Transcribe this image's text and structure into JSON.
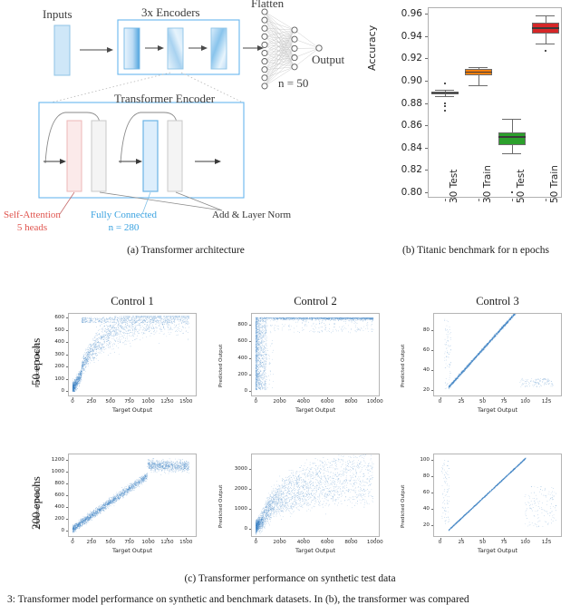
{
  "figure": {
    "caption_a": "(a) Transformer architecture",
    "caption_b": "(b) Titanic benchmark for n epochs",
    "caption_c": "(c) Transformer performance on synthetic test data",
    "caption_fig": "3: Transformer model performance on synthetic and benchmark datasets. In (b), the transformer was compared"
  },
  "architecture": {
    "inputs_label": "Inputs",
    "encoders_label": "3x Encoders",
    "flatten_label": "Flatten",
    "output_label": "Output",
    "dense_n_label": "n = 50",
    "encoder_box_label": "Transformer Encoder",
    "self_attention_label": "Self-Attention",
    "self_attention_sub": "5 heads",
    "fully_connected_label": "Fully Connected",
    "fully_connected_sub": "n = 280",
    "add_norm_label": "Add & Layer Norm",
    "colors": {
      "attention": "#fbe9e9",
      "attention_text": "#e0554f",
      "fully_connected": "#ddeefc",
      "fully_connected_text": "#3aa2e0",
      "box_border": "#67b6ee",
      "norm": "#f2f2f2"
    }
  },
  "chart_data": [
    {
      "id": "titanic-boxplot",
      "type": "boxplot",
      "title": "",
      "xlabel": "",
      "ylabel": "Accuracy",
      "ylim": [
        0.795,
        0.966
      ],
      "yticks": [
        0.8,
        0.82,
        0.84,
        0.86,
        0.88,
        0.9,
        0.92,
        0.94,
        0.96
      ],
      "ytick_labels": [
        "0.80",
        "0.82",
        "0.84",
        "0.86",
        "0.88",
        "0.90",
        "0.92",
        "0.94",
        "0.96"
      ],
      "categories": [
        "30 Test",
        "30 Train",
        "50 Test",
        "50 Train"
      ],
      "colors": [
        "#1f77b4",
        "#ff7f0e",
        "#2ca02c",
        "#d62728"
      ],
      "boxes": [
        {
          "label": "30 Test",
          "q1": 0.8875,
          "median": 0.889,
          "q3": 0.89,
          "whisker_low": 0.8865,
          "whisker_high": 0.8915,
          "fliers": [
            0.8975,
            0.88,
            0.8775,
            0.873
          ]
        },
        {
          "label": "30 Train",
          "q1": 0.905,
          "median": 0.9078,
          "q3": 0.9105,
          "whisker_low": 0.896,
          "whisker_high": 0.912,
          "fliers": []
        },
        {
          "label": "50 Test",
          "q1": 0.842,
          "median": 0.8495,
          "q3": 0.854,
          "whisker_low": 0.835,
          "whisker_high": 0.866,
          "fliers": [
            0.7995
          ]
        },
        {
          "label": "50 Train",
          "q1": 0.9425,
          "median": 0.9475,
          "q3": 0.952,
          "whisker_low": 0.9335,
          "whisker_high": 0.9585,
          "fliers": [
            0.927
          ]
        }
      ]
    },
    {
      "id": "control-1-50-epochs",
      "type": "scatter",
      "title": "Control 1",
      "row_label": "50 epochs",
      "xlabel": "Target Output",
      "ylabel": "Predicted Output",
      "xlim": [
        -60,
        1640
      ],
      "ylim": [
        -45,
        640
      ],
      "xticks": [
        0,
        250,
        500,
        750,
        1000,
        1250,
        1500
      ],
      "yticks": [
        0,
        100,
        200,
        300,
        400,
        500,
        600
      ],
      "point_color": "#3a7fc1",
      "n_points": 3000,
      "pattern": "saturating-fan",
      "saturation_y": 600
    },
    {
      "id": "control-2-50-epochs",
      "type": "scatter",
      "title": "Control 2",
      "row_label": "50 epochs",
      "xlabel": "Target Output",
      "ylabel": "Predicted Output",
      "xlim": [
        -400,
        10400
      ],
      "ylim": [
        -60,
        940
      ],
      "xticks": [
        0,
        2000,
        4000,
        6000,
        8000,
        10000
      ],
      "yticks": [
        0,
        200,
        400,
        600,
        800
      ],
      "point_color": "#3a7fc1",
      "n_points": 3000,
      "pattern": "hard-saturation-left-column",
      "saturation_y": 890
    },
    {
      "id": "control-3-50-epochs",
      "type": "scatter",
      "title": "Control 3",
      "row_label": "50 epochs",
      "xlabel": "Target Output",
      "ylabel": "Predicted Output",
      "xlim": [
        -8,
        143
      ],
      "ylim": [
        14,
        97
      ],
      "xticks": [
        0,
        25,
        50,
        75,
        100,
        125
      ],
      "yticks": [
        20,
        40,
        60,
        80
      ],
      "point_color": "#3a7fc1",
      "n_points": 2200,
      "pattern": "diagonal-with-offcluster",
      "slope": 0.95
    },
    {
      "id": "control-1-200-epochs",
      "type": "scatter",
      "title": "Control 1",
      "row_label": "200 epochs",
      "xlabel": "Target Output",
      "ylabel": "Predicted Output",
      "xlim": [
        -60,
        1640
      ],
      "ylim": [
        -110,
        1300
      ],
      "xticks": [
        0,
        250,
        500,
        750,
        1000,
        1250,
        1500
      ],
      "yticks": [
        0,
        200,
        400,
        600,
        800,
        1000,
        1200
      ],
      "point_color": "#3a7fc1",
      "n_points": 3000,
      "pattern": "linear-with-plateau",
      "plateau_x": 1000
    },
    {
      "id": "control-2-200-epochs",
      "type": "scatter",
      "title": "Control 2",
      "row_label": "200 epochs",
      "xlabel": "Target Output",
      "ylabel": "Predicted Output",
      "xlim": [
        -400,
        10400
      ],
      "ylim": [
        -420,
        3750
      ],
      "xticks": [
        0,
        2000,
        4000,
        6000,
        8000,
        10000
      ],
      "yticks": [
        0,
        1000,
        2000,
        3000
      ],
      "point_color": "#3a7fc1",
      "n_points": 3000,
      "pattern": "compressed-fan"
    },
    {
      "id": "control-3-200-epochs",
      "type": "scatter",
      "title": "Control 3",
      "row_label": "200 epochs",
      "xlabel": "Target Output",
      "ylabel": "Predicted Output",
      "xlim": [
        -8,
        143
      ],
      "ylim": [
        5,
        108
      ],
      "xticks": [
        0,
        25,
        50,
        75,
        100,
        125
      ],
      "yticks": [
        20,
        40,
        60,
        80,
        100
      ],
      "point_color": "#3a7fc1",
      "n_points": 2200,
      "pattern": "tight-diagonal-with-offcluster",
      "slope": 1.0
    }
  ]
}
